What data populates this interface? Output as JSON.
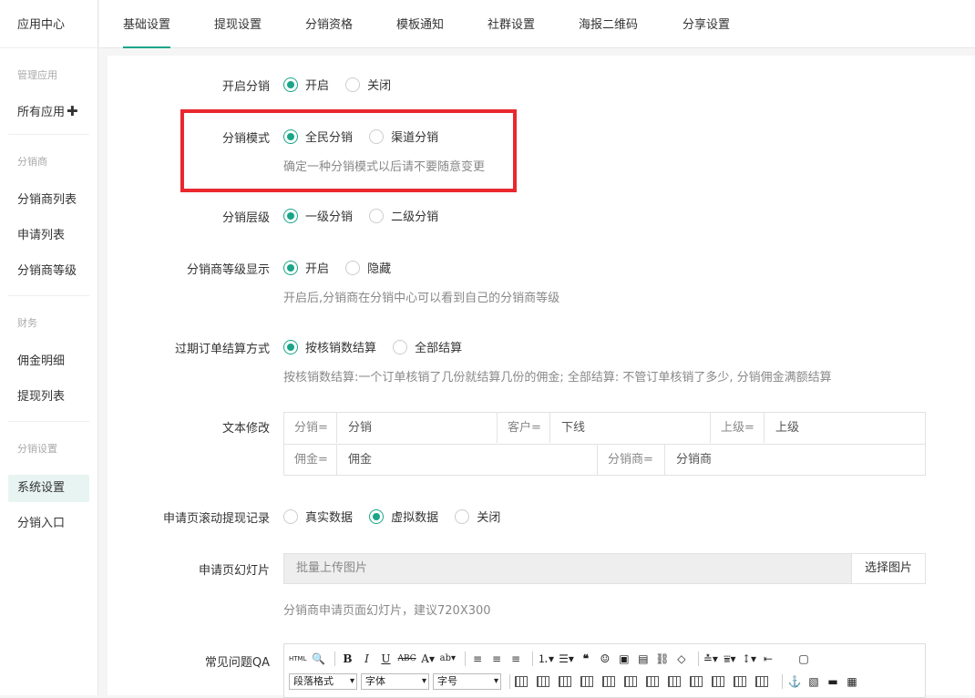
{
  "sidebar": {
    "title": "应用中心",
    "groups": [
      {
        "label": "管理应用",
        "items": [
          {
            "label": "所有应用"
          }
        ]
      },
      {
        "label": "分销商",
        "items": [
          {
            "label": "分销商列表"
          },
          {
            "label": "申请列表"
          },
          {
            "label": "分销商等级"
          }
        ]
      },
      {
        "label": "财务",
        "items": [
          {
            "label": "佣金明细"
          },
          {
            "label": "提现列表"
          }
        ]
      },
      {
        "label": "分销设置",
        "items": [
          {
            "label": "系统设置",
            "active": true
          },
          {
            "label": "分销入口"
          }
        ]
      }
    ]
  },
  "tabs": [
    {
      "label": "基础设置",
      "active": true
    },
    {
      "label": "提现设置"
    },
    {
      "label": "分销资格"
    },
    {
      "label": "模板通知"
    },
    {
      "label": "社群设置"
    },
    {
      "label": "海报二维码"
    },
    {
      "label": "分享设置"
    }
  ],
  "form": {
    "enable": {
      "label": "开启分销",
      "options": [
        "开启",
        "关闭"
      ],
      "selected": 0
    },
    "mode": {
      "label": "分销模式",
      "options": [
        "全民分销",
        "渠道分销"
      ],
      "selected": 0,
      "hint": "确定一种分销模式以后请不要随意变更"
    },
    "level": {
      "label": "分销层级",
      "options": [
        "一级分销",
        "二级分销"
      ],
      "selected": 0
    },
    "grade_display": {
      "label": "分销商等级显示",
      "options": [
        "开启",
        "隐藏"
      ],
      "selected": 0,
      "hint": "开启后,分销商在分销中心可以看到自己的分销商等级"
    },
    "settle": {
      "label": "过期订单结算方式",
      "options": [
        "按核销数结算",
        "全部结算"
      ],
      "selected": 0,
      "hint": "按核销数结算:一个订单核销了几份就结算几份的佣金; 全部结算:  不管订单核销了多少,  分销佣金满额结算"
    },
    "text_edit": {
      "label": "文本修改",
      "row1": [
        {
          "key": "分销=",
          "value": "分销"
        },
        {
          "key": "客户=",
          "value": "下线"
        },
        {
          "key": "上级=",
          "value": "上级"
        }
      ],
      "row2": [
        {
          "key": "佣金=",
          "value": "佣金"
        },
        {
          "key": "分销商=",
          "value": "分销商"
        }
      ]
    },
    "scroll_record": {
      "label": "申请页滚动提现记录",
      "options": [
        "真实数据",
        "虚拟数据",
        "关闭"
      ],
      "selected": 1
    },
    "slideshow": {
      "label": "申请页幻灯片",
      "placeholder": "批量上传图片",
      "button": "选择图片",
      "hint": "分销商申请页面幻灯片，建议720X300"
    },
    "qa": {
      "label": "常见问题QA"
    }
  },
  "editor": {
    "row1": [
      "HTML",
      "🔍",
      "B",
      "I",
      "U",
      "ABC",
      "A▾",
      "ab▾",
      "≡",
      "≡",
      "≡",
      "1≡▾",
      "•≡▾",
      "❝",
      "☺",
      "▣",
      "▤",
      "⛓",
      "◇",
      "A▾",
      "▽▾",
      "↕▾",
      "⇤",
      "▢"
    ],
    "row2_selects": [
      "段落格式",
      "字体",
      "字号"
    ],
    "row2_icons": [
      "⊞",
      "⊟",
      "⊞",
      "⊞",
      "⊞",
      "⊞",
      "⊞",
      "⊞",
      "⊞",
      "⊞",
      "⊞",
      "⊞",
      "⚓",
      "▧",
      "🖶",
      "▦"
    ]
  },
  "colors": {
    "accent": "#1aa588",
    "highlight_box": "#e8282d"
  }
}
